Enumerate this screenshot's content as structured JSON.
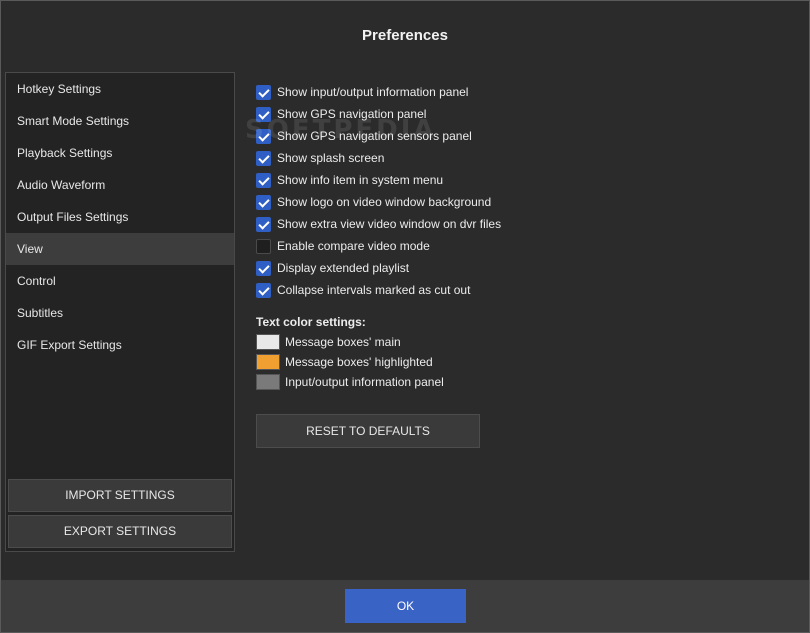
{
  "window": {
    "title": "Preferences"
  },
  "sidebar": {
    "items": [
      {
        "label": "Hotkey Settings",
        "active": false
      },
      {
        "label": "Smart Mode Settings",
        "active": false
      },
      {
        "label": "Playback Settings",
        "active": false
      },
      {
        "label": "Audio Waveform",
        "active": false
      },
      {
        "label": "Output Files Settings",
        "active": false
      },
      {
        "label": "View",
        "active": true
      },
      {
        "label": "Control",
        "active": false
      },
      {
        "label": "Subtitles",
        "active": false
      },
      {
        "label": "GIF Export Settings",
        "active": false
      }
    ],
    "import_label": "IMPORT SETTINGS",
    "export_label": "EXPORT SETTINGS"
  },
  "options": [
    {
      "label": "Show input/output information panel",
      "checked": true
    },
    {
      "label": "Show GPS navigation panel",
      "checked": true
    },
    {
      "label": "Show GPS navigation sensors panel",
      "checked": true
    },
    {
      "label": "Show splash screen",
      "checked": true
    },
    {
      "label": "Show info item in system menu",
      "checked": true
    },
    {
      "label": "Show logo on video window background",
      "checked": true
    },
    {
      "label": "Show extra view video window on dvr files",
      "checked": true
    },
    {
      "label": "Enable compare video mode",
      "checked": false
    },
    {
      "label": "Display extended playlist",
      "checked": true
    },
    {
      "label": "Collapse intervals marked as cut out",
      "checked": true
    }
  ],
  "text_colors": {
    "heading": "Text color settings:",
    "items": [
      {
        "label": "Message boxes' main",
        "color": "#e8e8e8"
      },
      {
        "label": "Message boxes' highlighted",
        "color": "#f0a030"
      },
      {
        "label": "Input/output information panel",
        "color": "#7a7a7a"
      }
    ]
  },
  "reset_label": "RESET TO DEFAULTS",
  "ok_label": "OK",
  "watermark": "SOFTPEDIA"
}
